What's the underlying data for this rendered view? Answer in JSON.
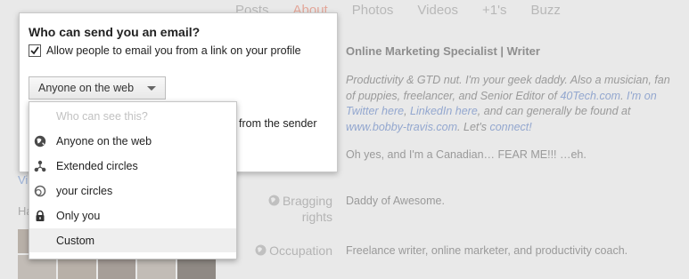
{
  "tabs": [
    "Posts",
    "About",
    "Photos",
    "Videos",
    "+1's",
    "Buzz"
  ],
  "active_tab": "About",
  "profile": {
    "headline": "Online Marketing Specialist | Writer",
    "intro_pre": "Productivity & GTD nut. I'm your geek daddy. Also a musician, fan of puppies, freelancer, and Senior Editor of ",
    "intro_link1": "40Tech.com",
    "intro_mid1": ". ",
    "intro_link2": "I'm on Twitter here",
    "intro_mid2": ", ",
    "intro_link3": "LinkedIn here",
    "intro_mid3": ", and can generally be found at ",
    "intro_link4": "www.bobby-travis.com",
    "intro_mid4": ". Let's ",
    "intro_link5": "connect!",
    "canadian": "Oh yes, and I'm a Canadian… FEAR ME!!! …eh.",
    "bragging_label_1": "Bragging",
    "bragging_label_2": "rights",
    "bragging_value": "Daddy of Awesome.",
    "occupation_label": "Occupation",
    "occupation_value": "Freelance writer, online marketer, and productivity coach."
  },
  "left_col": {
    "link": "Vi",
    "heading": "Ha"
  },
  "dialog": {
    "title": "Who can send you an email?",
    "checkbox_label": "Allow people to email you from a link on your profile",
    "checkbox_checked": true,
    "select_value": "Anyone on the web",
    "partial_text": "from the sender"
  },
  "dropdown": {
    "placeholder": "Who can see this?",
    "items": [
      {
        "label": "Anyone on the web",
        "icon": "globe-icon"
      },
      {
        "label": "Extended circles",
        "icon": "extended-circles-icon"
      },
      {
        "label": "your circles",
        "icon": "circles-icon"
      },
      {
        "label": "Only you",
        "icon": "lock-icon"
      },
      {
        "label": "Custom",
        "icon": ""
      }
    ],
    "hovered": "Custom"
  }
}
